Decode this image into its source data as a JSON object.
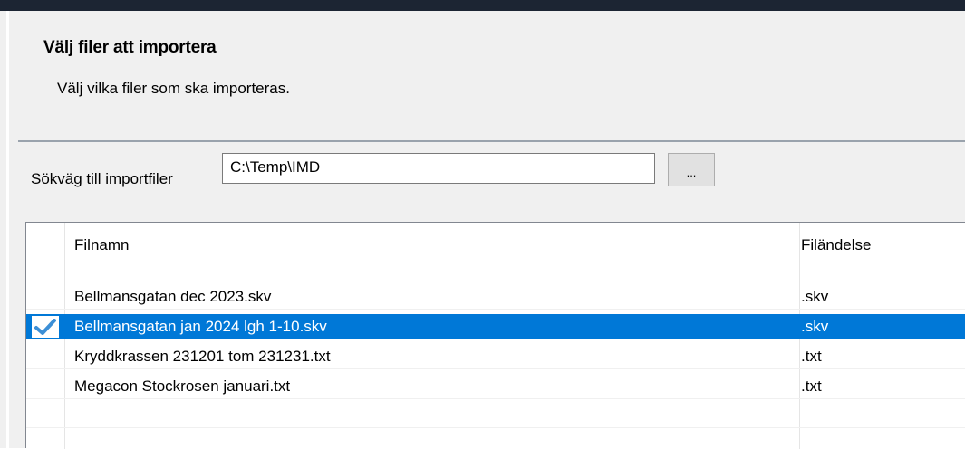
{
  "dialog": {
    "title": "Välj filer att importera",
    "subtitle": "Välj vilka filer som ska importeras."
  },
  "path": {
    "label": "Sökväg till importfiler",
    "value": "C:\\Temp\\IMD",
    "browse_label": "..."
  },
  "table": {
    "columns": [
      "Filnamn",
      "Filändelse"
    ],
    "rows": [
      {
        "name": "Bellmansgatan dec 2023.skv",
        "ext": ".skv",
        "checked": false,
        "selected": false
      },
      {
        "name": "Bellmansgatan jan 2024 lgh 1-10.skv",
        "ext": ".skv",
        "checked": true,
        "selected": true
      },
      {
        "name": "Kryddkrassen 231201 tom 231231.txt",
        "ext": ".txt",
        "checked": false,
        "selected": false
      },
      {
        "name": "Megacon Stockrosen januari.txt",
        "ext": ".txt",
        "checked": false,
        "selected": false
      }
    ]
  },
  "colors": {
    "selection": "#0078d7",
    "checkmark": "#3c8fd6",
    "titlebar": "#1c2533"
  },
  "icons": {
    "check": "checkmark-icon"
  }
}
